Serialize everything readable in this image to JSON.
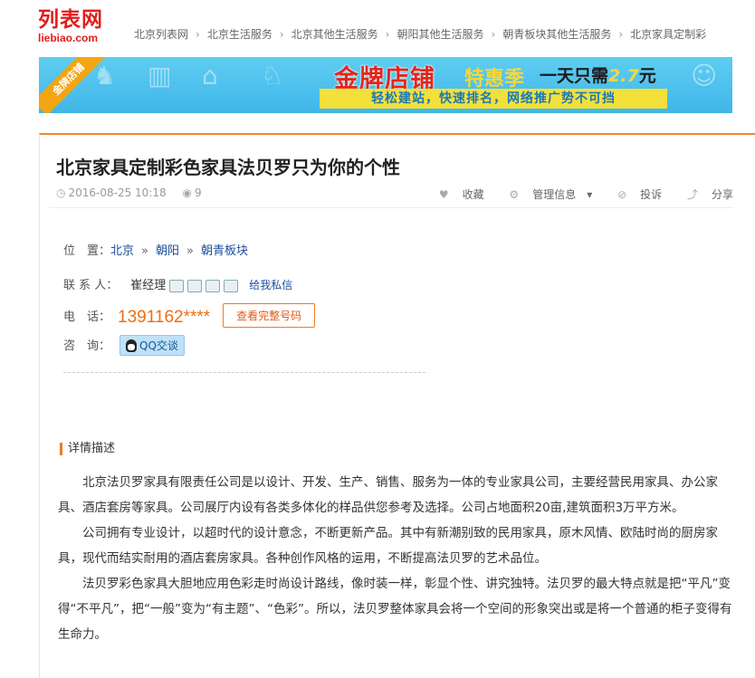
{
  "logo": {
    "cn": "列表网",
    "en": "liebiao.com"
  },
  "breadcrumb": [
    "北京列表网",
    "北京生活服务",
    "北京其他生活服务",
    "朝阳其他生活服务",
    "朝青板块其他生活服务",
    "北京家具定制彩"
  ],
  "banner": {
    "ribbon": "金牌店铺",
    "headline": "金牌店铺",
    "promo": "特惠季",
    "price_prefix": "一天只需",
    "price": "2.7",
    "price_unit": "元",
    "tagline": "轻松建站，快速排名，网络推广势不可挡"
  },
  "post": {
    "title": "北京家具定制彩色家具法贝罗只为你的个性",
    "date": "2016-08-25 10:18",
    "views": "9",
    "actions": {
      "favorite": "收藏",
      "manage": "管理信息",
      "report": "投诉",
      "share": "分享"
    }
  },
  "location": {
    "label": "位　置：",
    "levels": [
      "北京",
      "朝阳",
      "朝青板块"
    ]
  },
  "contact": {
    "label": "联 系 人：",
    "name": "崔经理",
    "pm": "给我私信"
  },
  "phone": {
    "label": "电　话：",
    "number": "1391162****",
    "button": "查看完整号码"
  },
  "consult": {
    "label": "咨　询：",
    "qq_button": "QQ交谈"
  },
  "details": {
    "heading": "详情描述",
    "paragraphs": [
      "北京法贝罗家具有限责任公司是以设计、开发、生产、销售、服务为一体的专业家具公司，主要经营民用家具、办公家具、酒店套房等家具。公司展厅内设有各类多体化的样品供您参考及选择。公司占地面积20亩,建筑面积3万平方米。",
      "公司拥有专业设计，以超时代的设计意念，不断更新产品。其中有新潮别致的民用家具，原木风情、欧陆时尚的厨房家具，现代而结实耐用的酒店套房家具。各种创作风格的运用，不断提高法贝罗的艺术品位。",
      "法贝罗彩色家具大胆地应用色彩走时尚设计路线，像时装一样，彰显个性、讲究独特。法贝罗的最大特点就是把“平凡”变得“不平凡”，把“一般”变为“有主题”、“色彩”。所以，法贝罗整体家具会将一个空间的形象突出或是将一个普通的柜子变得有生命力。"
    ]
  },
  "colors": {
    "brand": "#e01e1e",
    "accent": "#ef8b29",
    "phone": "#f06d12",
    "link": "#1c4e9c"
  }
}
